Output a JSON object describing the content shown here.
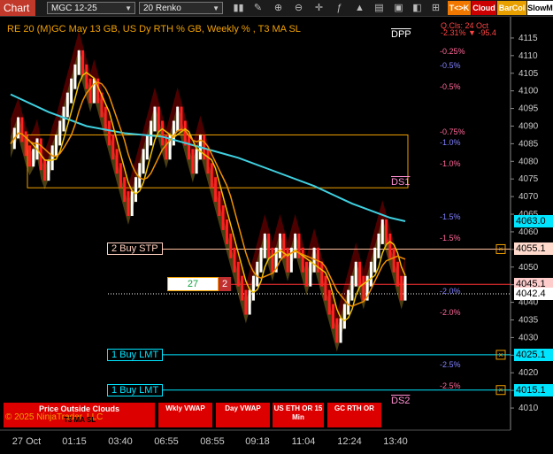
{
  "toolbar": {
    "chart_tab": "Chart",
    "instrument": "MGC 12-25",
    "bar_type": "20 Renko",
    "btn_tk": "T<>K",
    "btn_cloud": "Cloud",
    "btn_barcol": "BarCol",
    "btn_slowm": "SlowM",
    "colors": {
      "tk": "#f07800",
      "cloud": "#cc0000",
      "barcol": "#e8a000",
      "slowm": "#ffffff"
    }
  },
  "chart": {
    "title": "RE 20  (M)GC May 13 GB, US Dy RTH % GB, Weekly % , T3 MA SL",
    "top_right_label": "Q.Cls: 24 Oct",
    "top_right_values": "-2.31% ▼ -95.4",
    "copyright": "© 2025 NinjaTrader, LLC",
    "t3_label": "T3 MA SL"
  },
  "chart_data": {
    "type": "line",
    "ylim": [
      4007,
      4119
    ],
    "y_ticks": [
      4010,
      4015,
      4020,
      4025,
      4030,
      4035,
      4040,
      4045,
      4050,
      4055,
      4060,
      4065,
      4070,
      4075,
      4080,
      4085,
      4090,
      4095,
      4100,
      4105,
      4110,
      4115
    ],
    "x_ticks": [
      "27 Oct",
      "01:15",
      "03:40",
      "06:55",
      "08:55",
      "09:18",
      "11:04",
      "12:24",
      "13:40"
    ],
    "price_badges": [
      {
        "label": "4063.0",
        "value": 4063.0,
        "bg": "#00e5ff",
        "fg": "#000000"
      },
      {
        "label": "4055.1",
        "value": 4055.1,
        "bg": "#ffd9cc",
        "fg": "#000000"
      },
      {
        "label": "4045.1",
        "value": 4045.1,
        "bg": "#ffcccc",
        "fg": "#000000"
      },
      {
        "label": "4042.4",
        "value": 4042.4,
        "bg": "#ffffff",
        "fg": "#000000"
      },
      {
        "label": "4025.1",
        "value": 4025.1,
        "bg": "#00e5ff",
        "fg": "#000000"
      },
      {
        "label": "4015.1",
        "value": 4015.1,
        "bg": "#00e5ff",
        "fg": "#000000"
      }
    ],
    "pct_levels": [
      {
        "label": "-0.25%",
        "value": 4111,
        "color": "#ff6699"
      },
      {
        "label": "-0.5%",
        "value": 4107,
        "color": "#8080ff"
      },
      {
        "label": "-0.5%",
        "value": 4101,
        "color": "#ff6699"
      },
      {
        "label": "-0.75%",
        "value": 4088,
        "color": "#ff6699"
      },
      {
        "label": "-1.0%",
        "value": 4085,
        "color": "#8080ff"
      },
      {
        "label": "-1.0%",
        "value": 4079,
        "color": "#ff6699"
      },
      {
        "label": "-1.5%",
        "value": 4064,
        "color": "#8080ff"
      },
      {
        "label": "-1.5%",
        "value": 4058,
        "color": "#ff6699"
      },
      {
        "label": "-2.0%",
        "value": 4043,
        "color": "#8080ff"
      },
      {
        "label": "-2.0%",
        "value": 4037,
        "color": "#ff6699"
      },
      {
        "label": "-2.5%",
        "value": 4022,
        "color": "#8080ff"
      },
      {
        "label": "-2.5%",
        "value": 4016,
        "color": "#ff6699"
      }
    ],
    "pivots": [
      {
        "label": "DPP",
        "value": 4116
      },
      {
        "label": "DS1",
        "value": 4074
      },
      {
        "label": "DS2",
        "value": 4012
      }
    ],
    "orders": [
      {
        "label": "2 Buy STP",
        "value": 4055.1,
        "color": "#ffd0c0",
        "line": "#ffc0a0"
      },
      {
        "label": "1 Buy LMT",
        "value": 4025.1,
        "color": "#00e5ff",
        "line": "#00e5ff"
      },
      {
        "label": "1 Buy LMT",
        "value": 4015.1,
        "color": "#00e5ff",
        "line": "#00e5ff"
      }
    ],
    "position": {
      "qty": "27",
      "side": "2",
      "value": 4045.1
    },
    "zone": {
      "top": 4087.5,
      "bottom": 4072.5
    },
    "price_path": [
      [
        0,
        4085
      ],
      [
        1,
        4088
      ],
      [
        2,
        4091
      ],
      [
        3,
        4087
      ],
      [
        4,
        4083
      ],
      [
        5,
        4080
      ],
      [
        6,
        4082
      ],
      [
        7,
        4085
      ],
      [
        8,
        4079
      ],
      [
        9,
        4076
      ],
      [
        10,
        4079
      ],
      [
        11,
        4083
      ],
      [
        12,
        4086
      ],
      [
        13,
        4090
      ],
      [
        14,
        4094
      ],
      [
        15,
        4098
      ],
      [
        16,
        4102
      ],
      [
        17,
        4106
      ],
      [
        18,
        4110
      ],
      [
        19,
        4106
      ],
      [
        20,
        4102
      ],
      [
        21,
        4098
      ],
      [
        22,
        4102
      ],
      [
        23,
        4098
      ],
      [
        24,
        4094
      ],
      [
        25,
        4090
      ],
      [
        26,
        4086
      ],
      [
        27,
        4082
      ],
      [
        28,
        4078
      ],
      [
        29,
        4074
      ],
      [
        30,
        4070
      ],
      [
        31,
        4066
      ],
      [
        32,
        4070
      ],
      [
        33,
        4074
      ],
      [
        34,
        4078
      ],
      [
        35,
        4082
      ],
      [
        36,
        4086
      ],
      [
        37,
        4090
      ],
      [
        38,
        4094
      ],
      [
        39,
        4090
      ],
      [
        40,
        4086
      ],
      [
        41,
        4082
      ],
      [
        42,
        4086
      ],
      [
        43,
        4090
      ],
      [
        44,
        4094
      ],
      [
        45,
        4090
      ],
      [
        46,
        4086
      ],
      [
        47,
        4082
      ],
      [
        48,
        4078
      ],
      [
        49,
        4082
      ],
      [
        50,
        4086
      ],
      [
        51,
        4082
      ],
      [
        52,
        4078
      ],
      [
        53,
        4074
      ],
      [
        54,
        4070
      ],
      [
        55,
        4066
      ],
      [
        56,
        4062
      ],
      [
        57,
        4058
      ],
      [
        58,
        4054
      ],
      [
        59,
        4050
      ],
      [
        60,
        4046
      ],
      [
        61,
        4042
      ],
      [
        62,
        4038
      ],
      [
        63,
        4042
      ],
      [
        64,
        4046
      ],
      [
        65,
        4050
      ],
      [
        66,
        4054
      ],
      [
        67,
        4058
      ],
      [
        68,
        4054
      ],
      [
        69,
        4050
      ],
      [
        70,
        4054
      ],
      [
        71,
        4058
      ],
      [
        72,
        4054
      ],
      [
        73,
        4050
      ],
      [
        74,
        4054
      ],
      [
        75,
        4058
      ],
      [
        76,
        4054
      ],
      [
        77,
        4050
      ],
      [
        78,
        4046
      ],
      [
        79,
        4050
      ],
      [
        80,
        4054
      ],
      [
        81,
        4050
      ],
      [
        82,
        4046
      ],
      [
        83,
        4042
      ],
      [
        84,
        4038
      ],
      [
        85,
        4034
      ],
      [
        86,
        4030
      ],
      [
        87,
        4034
      ],
      [
        88,
        4038
      ],
      [
        89,
        4042
      ],
      [
        90,
        4046
      ],
      [
        91,
        4050
      ],
      [
        92,
        4046
      ],
      [
        93,
        4042
      ],
      [
        94,
        4046
      ],
      [
        95,
        4050
      ],
      [
        96,
        4054
      ],
      [
        97,
        4058
      ],
      [
        98,
        4062
      ],
      [
        99,
        4058
      ],
      [
        100,
        4054
      ],
      [
        101,
        4050
      ],
      [
        102,
        4046
      ],
      [
        103,
        4042
      ],
      [
        104,
        4046
      ]
    ],
    "cyan_ma": [
      [
        0,
        4099
      ],
      [
        10,
        4094
      ],
      [
        20,
        4090
      ],
      [
        30,
        4088
      ],
      [
        40,
        4087
      ],
      [
        50,
        4084
      ],
      [
        60,
        4081
      ],
      [
        70,
        4077
      ],
      [
        80,
        4073
      ],
      [
        90,
        4068
      ],
      [
        100,
        4064
      ],
      [
        104,
        4063
      ]
    ]
  },
  "panel_buttons": [
    {
      "label": "Price Outside Clouds"
    },
    {
      "label": "Wkly VWAP"
    },
    {
      "label": "Day VWAP"
    },
    {
      "label": "US ETH OR 15 Min"
    },
    {
      "label": "GC RTH OR"
    }
  ]
}
